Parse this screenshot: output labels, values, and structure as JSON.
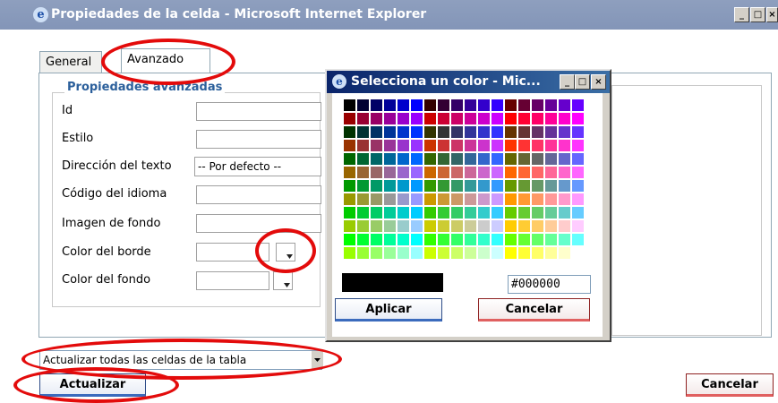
{
  "window": {
    "title": "Propiedades de la celda - Microsoft Internet Explorer"
  },
  "tabs": [
    {
      "label": "General"
    },
    {
      "label": "Avanzado"
    }
  ],
  "section": {
    "legend": "Propiedades avanzadas"
  },
  "fields": {
    "id": {
      "label": "Id",
      "value": ""
    },
    "style": {
      "label": "Estilo",
      "value": ""
    },
    "direction": {
      "label": "Dirección del texto",
      "value": "-- Por defecto --"
    },
    "lang": {
      "label": "Código del idioma",
      "value": ""
    },
    "bg_image": {
      "label": "Imagen de fondo",
      "value": ""
    },
    "border_color": {
      "label": "Color del borde",
      "value": ""
    },
    "bg_color": {
      "label": "Color del fondo",
      "value": ""
    }
  },
  "apply_scope": {
    "value": "Actualizar todas las celdas de la tabla"
  },
  "buttons": {
    "update": "Actualizar",
    "cancel": "Cancelar"
  },
  "color_picker": {
    "title": "Selecciona un color - Mic...",
    "hex_value": "#000000",
    "preview_color": "#000000",
    "apply_label": "Aplicar",
    "cancel_label": "Cancelar",
    "colors": [
      "#000000",
      "#000033",
      "#000066",
      "#000099",
      "#0000cc",
      "#0000ff",
      "#330000",
      "#330033",
      "#330066",
      "#330099",
      "#3300cc",
      "#3300ff",
      "#660000",
      "#660033",
      "#660066",
      "#660099",
      "#6600cc",
      "#6600ff",
      "#990000",
      "#990033",
      "#990066",
      "#990099",
      "#9900cc",
      "#9900ff",
      "#cc0000",
      "#cc0033",
      "#cc0066",
      "#cc0099",
      "#cc00cc",
      "#cc00ff",
      "#ff0000",
      "#ff0033",
      "#ff0066",
      "#ff0099",
      "#ff00cc",
      "#ff00ff",
      "#003300",
      "#003333",
      "#003366",
      "#003399",
      "#0033cc",
      "#0033ff",
      "#333300",
      "#333333",
      "#333366",
      "#333399",
      "#3333cc",
      "#3333ff",
      "#663300",
      "#663333",
      "#663366",
      "#663399",
      "#6633cc",
      "#6633ff",
      "#993300",
      "#993333",
      "#993366",
      "#993399",
      "#9933cc",
      "#9933ff",
      "#cc3300",
      "#cc3333",
      "#cc3366",
      "#cc3399",
      "#cc33cc",
      "#cc33ff",
      "#ff3300",
      "#ff3333",
      "#ff3366",
      "#ff3399",
      "#ff33cc",
      "#ff33ff",
      "#006600",
      "#006633",
      "#006666",
      "#006699",
      "#0066cc",
      "#0066ff",
      "#336600",
      "#336633",
      "#336666",
      "#336699",
      "#3366cc",
      "#3366ff",
      "#666600",
      "#666633",
      "#666666",
      "#666699",
      "#6666cc",
      "#6666ff",
      "#996600",
      "#996633",
      "#996666",
      "#996699",
      "#9966cc",
      "#9966ff",
      "#cc6600",
      "#cc6633",
      "#cc6666",
      "#cc6699",
      "#cc66cc",
      "#cc66ff",
      "#ff6600",
      "#ff6633",
      "#ff6666",
      "#ff6699",
      "#ff66cc",
      "#ff66ff",
      "#009900",
      "#009933",
      "#009966",
      "#009999",
      "#0099cc",
      "#0099ff",
      "#339900",
      "#339933",
      "#339966",
      "#339999",
      "#3399cc",
      "#3399ff",
      "#669900",
      "#669933",
      "#669966",
      "#669999",
      "#6699cc",
      "#6699ff",
      "#999900",
      "#999933",
      "#999966",
      "#999999",
      "#9999cc",
      "#9999ff",
      "#cc9900",
      "#cc9933",
      "#cc9966",
      "#cc9999",
      "#cc99cc",
      "#cc99ff",
      "#ff9900",
      "#ff9933",
      "#ff9966",
      "#ff9999",
      "#ff99cc",
      "#ff99ff",
      "#00cc00",
      "#00cc33",
      "#00cc66",
      "#00cc99",
      "#00cccc",
      "#00ccff",
      "#33cc00",
      "#33cc33",
      "#33cc66",
      "#33cc99",
      "#33cccc",
      "#33ccff",
      "#66cc00",
      "#66cc33",
      "#66cc66",
      "#66cc99",
      "#66cccc",
      "#66ccff",
      "#99cc00",
      "#99cc33",
      "#99cc66",
      "#99cc99",
      "#99cccc",
      "#99ccff",
      "#cccc00",
      "#cccc33",
      "#cccc66",
      "#cccc99",
      "#cccccc",
      "#ccccff",
      "#ffcc00",
      "#ffcc33",
      "#ffcc66",
      "#ffcc99",
      "#ffcccc",
      "#ffccff",
      "#00ff00",
      "#00ff33",
      "#00ff66",
      "#00ff99",
      "#00ffcc",
      "#00ffff",
      "#33ff00",
      "#33ff33",
      "#33ff66",
      "#33ff99",
      "#33ffcc",
      "#33ffff",
      "#66ff00",
      "#66ff33",
      "#66ff66",
      "#66ff99",
      "#66ffcc",
      "#66ffff",
      "#99ff00",
      "#99ff33",
      "#99ff66",
      "#99ff99",
      "#99ffcc",
      "#99ffff",
      "#ccff00",
      "#ccff33",
      "#ccff66",
      "#ccff99",
      "#ccffcc",
      "#ccffff",
      "#ffff00",
      "#ffff33",
      "#ffff66",
      "#ffff99",
      "#ffffcc",
      "#ffffff"
    ]
  },
  "highlight_color": "#e30b0b"
}
